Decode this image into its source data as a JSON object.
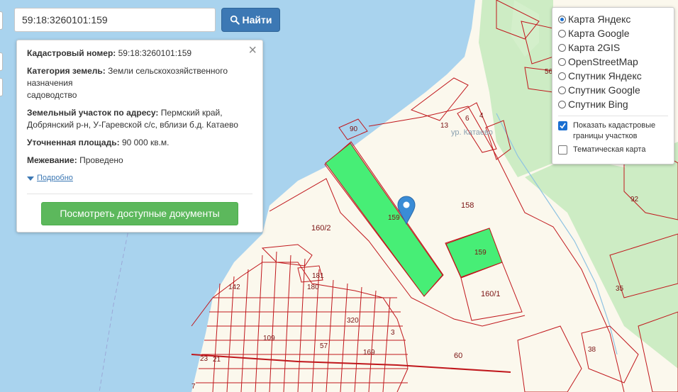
{
  "search": {
    "value": "59:18:3260101:159",
    "button_label": "Найти"
  },
  "popup": {
    "cadastral_label": "Кадастровый номер:",
    "cadastral_value": "59:18:3260101:159",
    "category_label": "Категория земель:",
    "category_value": "Земли сельскохозяйственного назначения",
    "category_use": "садоводство",
    "address_label": "Земельный участок по адресу:",
    "address_value": "Пермский край, Добрянский р-н, У-Гаревской с/с, вблизи б.д. Катаево",
    "area_label": "Уточненная площадь:",
    "area_value": "90 000 кв.м.",
    "survey_label": "Межевание:",
    "survey_value": "Проведено",
    "more_label": "Подробно",
    "docs_button": "Посмотреть доступные документы"
  },
  "layers": {
    "options": [
      "Карта Яндекс",
      "Карта Google",
      "Карта 2GIS",
      "OpenStreetMap",
      "Спутник Яндекс",
      "Спутник Google",
      "Спутник Bing"
    ],
    "selected": "Карта Яндекс",
    "show_boundaries_label": "Показать кадастровые границы участков",
    "show_boundaries_checked": true,
    "thematic_label": "Тематическая карта",
    "thematic_checked": false
  },
  "map": {
    "parcel_labels": {
      "p159": "159",
      "p159b": "159",
      "p158": "158",
      "p160_2": "160/2",
      "p160_1": "160/1",
      "p90": "90",
      "p13": "13",
      "p6": "6",
      "p4": "4",
      "p56": "56",
      "p92": "92",
      "p35": "35",
      "p60": "60",
      "p38": "38",
      "p142": "142",
      "p180": "180",
      "p181": "181",
      "p320": "320",
      "p109": "109",
      "p57": "57",
      "p169": "169",
      "p3": "3",
      "p23": "23",
      "p21": "21",
      "p7": "7"
    },
    "locality_label": "ур. Катаево",
    "colors": {
      "water": "#a9d3ee",
      "land": "#fbf8ed",
      "forest": "#cdecc4",
      "highlight": "#47ee76",
      "boundary": "#c0171c",
      "accent": "#3c78b4",
      "button_green": "#5cb85c"
    }
  }
}
